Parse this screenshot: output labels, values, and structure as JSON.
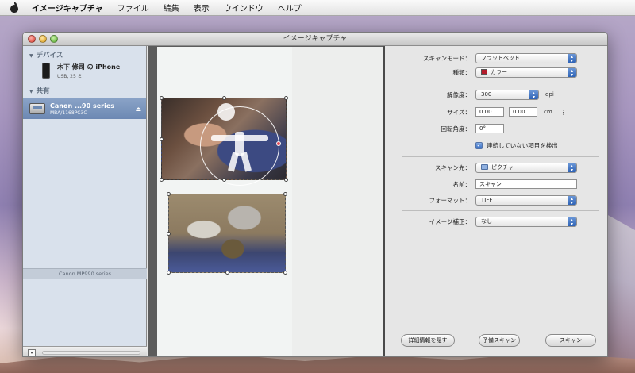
{
  "menubar": {
    "app_name": "イメージキャプチャ",
    "items": [
      "ファイル",
      "編集",
      "表示",
      "ウインドウ",
      "ヘルプ"
    ]
  },
  "window": {
    "title": "イメージキャプチャ"
  },
  "sidebar": {
    "devices_header": "デバイス",
    "device_name": "木下 修司 の iPhone",
    "device_sub": "USB, 25 ミ",
    "shared_header": "共有",
    "scanner_name": "Canon ...90 series",
    "scanner_sub": "MBA/1168PC3C",
    "status": "Canon MP990 series"
  },
  "settings": {
    "scan_mode_label": "スキャンモード：",
    "scan_mode_value": "フラットベッド",
    "type_label": "種類：",
    "type_value": "カラー",
    "resolution_label": "解像度：",
    "resolution_value": "300",
    "resolution_unit": "dpi",
    "size_label": "サイズ：",
    "size_w": "0.00",
    "size_h": "0.00",
    "size_unit": "cm",
    "rotation_label": "回転角度：",
    "rotation_value": "0°",
    "detect_label": "連続していない項目を検出",
    "scan_to_label": "スキャン先：",
    "scan_to_value": "ピクチャ",
    "name_label": "名前：",
    "name_value": "スキャン",
    "format_label": "フォーマット：",
    "format_value": "TIFF",
    "correction_label": "イメージ補正：",
    "correction_value": "なし"
  },
  "buttons": {
    "hide_details": "詳細情報を隠す",
    "overview": "予備スキャン",
    "scan": "スキャン"
  }
}
